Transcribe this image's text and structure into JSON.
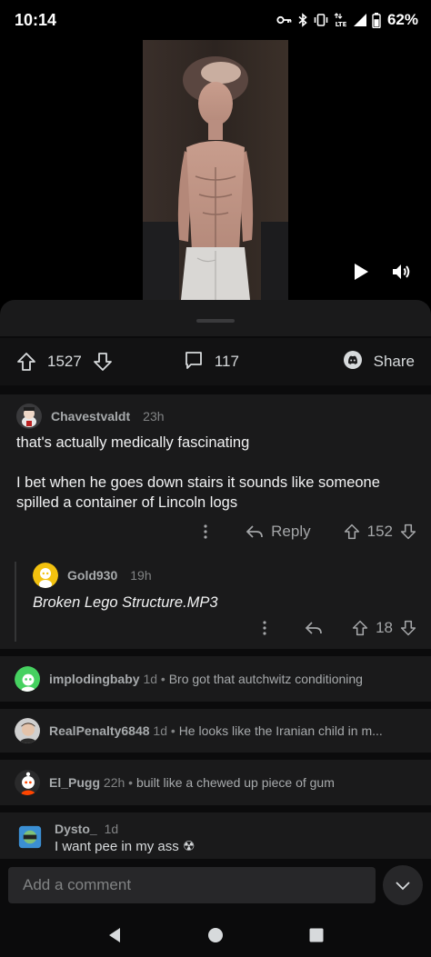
{
  "status": {
    "time": "10:14",
    "network": "4G LTE",
    "battery": "62%"
  },
  "post": {
    "upvotes": "1527",
    "comments": "117",
    "share_label": "Share"
  },
  "comments": [
    {
      "username": "Chavestvaldt",
      "age": "23h",
      "body_line1": "that's actually medically fascinating",
      "body_line2": "I bet when he goes down stairs it sounds like someone spilled a container of Lincoln logs",
      "reply_label": "Reply",
      "score": "152",
      "reply": {
        "username": "Gold930",
        "age": "19h",
        "body": "Broken Lego Structure.MP3",
        "score": "18"
      }
    },
    {
      "username": "implodingbaby",
      "age": "1d",
      "body": "Bro got that autchwitz conditioning"
    },
    {
      "username": "RealPenalty6848",
      "age": "1d",
      "body": "He looks like the Iranian child in m..."
    },
    {
      "username": "El_Pugg",
      "age": "22h",
      "body": "built like a chewed up piece of gum"
    },
    {
      "username": "Dysto_",
      "age": "1d",
      "body": "I want pee in my ass ☢"
    }
  ],
  "composer": {
    "placeholder": "Add a comment"
  },
  "icons": {
    "upvote": "arrow-up-outline-icon",
    "downvote": "arrow-down-outline-icon",
    "comment": "speech-bubble-icon",
    "share": "discord-share-icon",
    "more": "vertical-dots-icon",
    "reply": "reply-arrow-icon"
  },
  "colors": {
    "background": "#000000",
    "sheet": "#1a1a1b",
    "text_primary": "#f1f2f3",
    "text_secondary": "#a7aaac"
  }
}
